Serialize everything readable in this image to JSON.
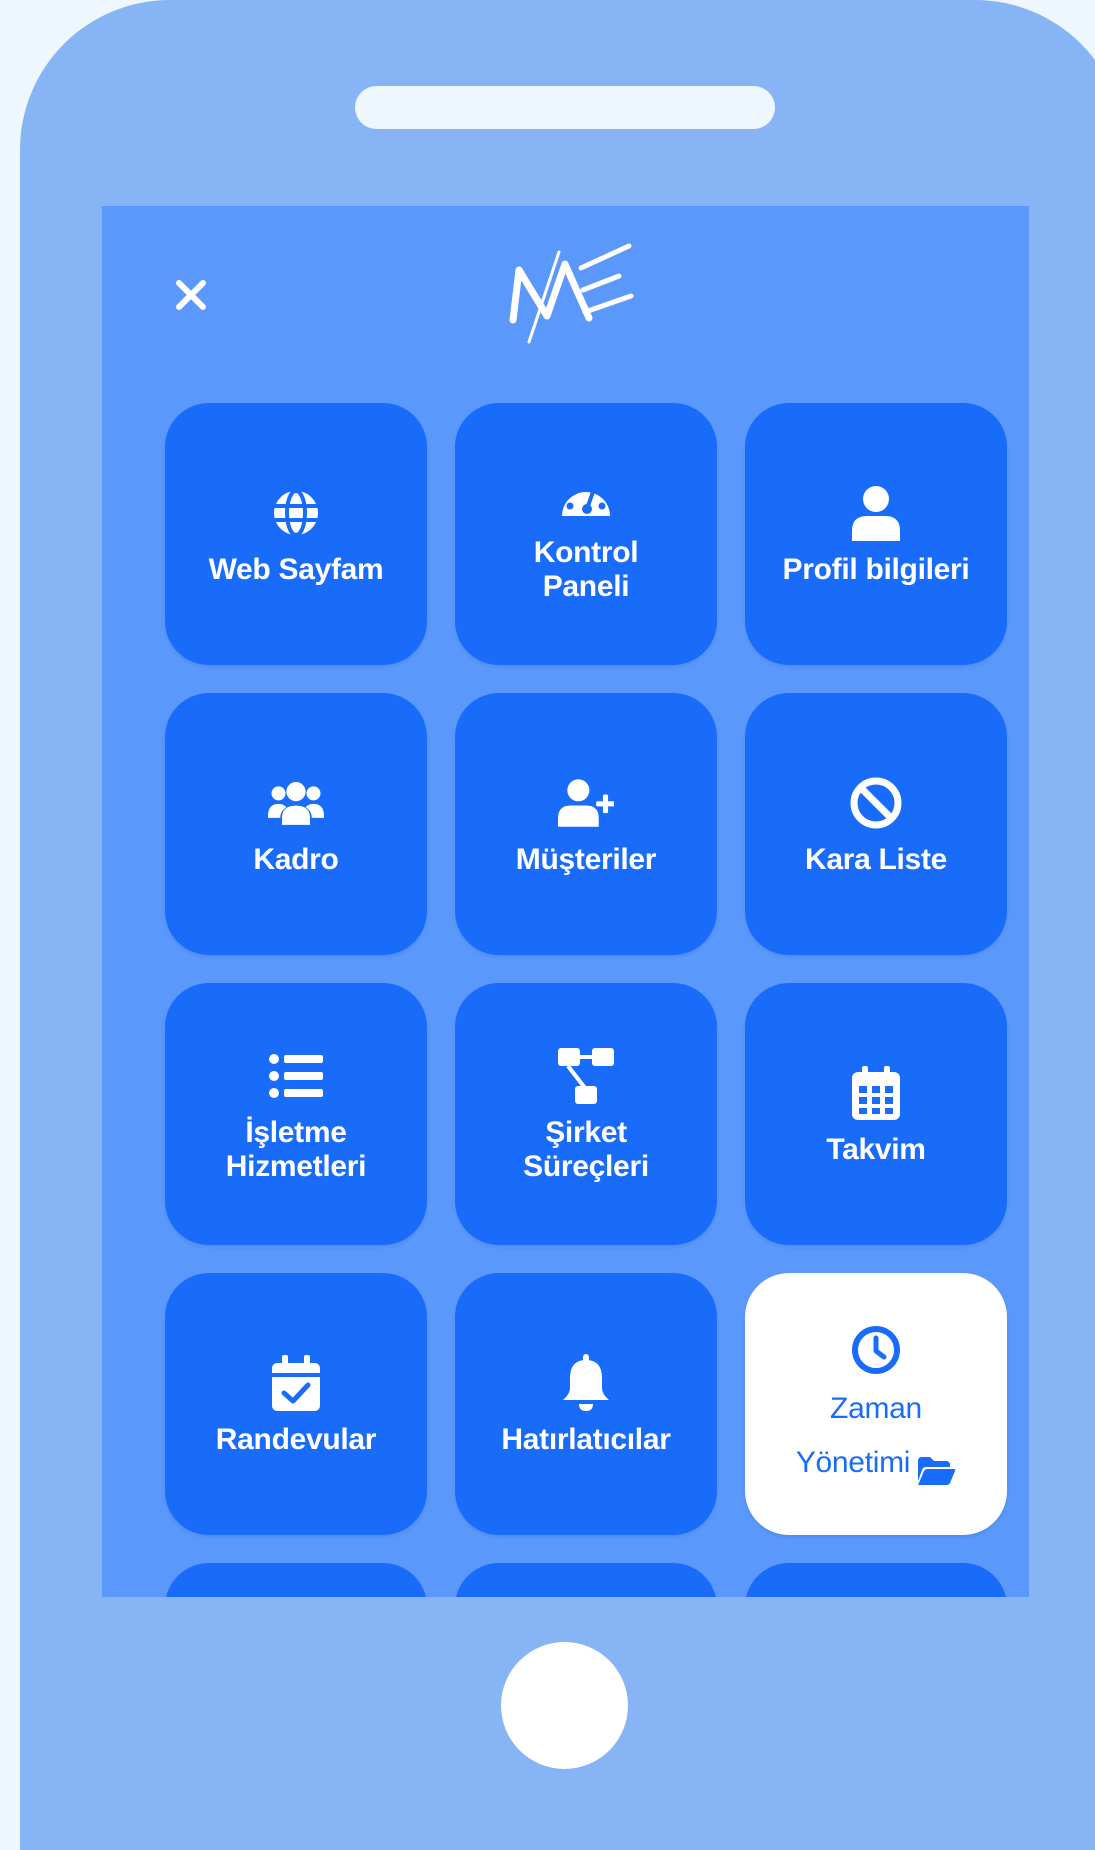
{
  "colors": {
    "page_background": "#eef7fd",
    "phone_body": "#86b4f4",
    "screen_background": "#5b98fb",
    "tile_background": "#196cf9",
    "active_tile_background": "#ffffff",
    "tile_text": "#ffffff",
    "active_tile_text": "#196cf9"
  },
  "header": {
    "close_icon": "close-icon",
    "logo_icon": "me-logo"
  },
  "menu": {
    "web_sayfam": {
      "label": "Web Sayfam",
      "icon": "globe-icon"
    },
    "kontrol_paneli": {
      "line1": "Kontrol",
      "line2": "Paneli",
      "icon": "speedometer-icon"
    },
    "profil_bilgileri": {
      "label": "Profil bilgileri",
      "icon": "user-icon"
    },
    "kadro": {
      "label": "Kadro",
      "icon": "users-icon"
    },
    "musteriler": {
      "label": "Müşteriler",
      "icon": "user-plus-icon"
    },
    "kara_liste": {
      "label": "Kara Liste",
      "icon": "ban-icon"
    },
    "isletme_hizmetleri": {
      "line1": "İşletme",
      "line2": "Hizmetleri",
      "icon": "list-icon"
    },
    "sirket_surecleri": {
      "line1": "Şirket",
      "line2": "Süreçleri",
      "icon": "sitemap-icon"
    },
    "takvim": {
      "label": "Takvim",
      "icon": "calendar-icon"
    },
    "randevular": {
      "label": "Randevular",
      "icon": "calendar-check-icon"
    },
    "hatirlaticilar": {
      "label": "Hatırlatıcılar",
      "icon": "bell-icon"
    },
    "zaman_yonetimi": {
      "line1": "Zaman",
      "line2": "Yönetimi",
      "icon": "clock-icon",
      "badge_icon": "folder-open-icon",
      "active": true
    }
  }
}
